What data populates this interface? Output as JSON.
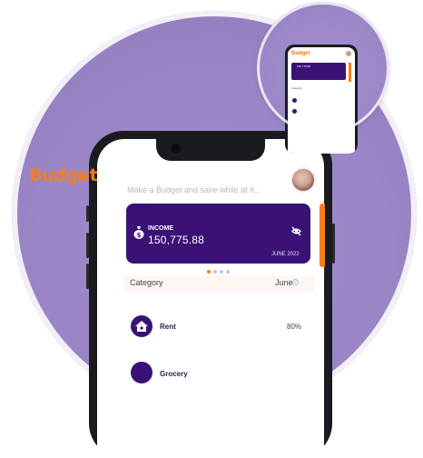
{
  "app": {
    "title": "Budget",
    "subtitle": "Make a Budget and save while at it..."
  },
  "income_card": {
    "label": "INCOME",
    "value": "150,775.88",
    "date": "JUNE 2022",
    "money_icon": "money-bag-icon",
    "eye_icon": "eye-off-icon"
  },
  "carousel": {
    "total": 4,
    "active_index": 0
  },
  "category_header": {
    "label": "Category",
    "month": "June"
  },
  "categories": [
    {
      "name": "Rent",
      "percent": "80%",
      "icon": "home-icon"
    },
    {
      "name": "Grocery",
      "percent": "",
      "icon": "cart-icon"
    }
  ],
  "mini": {
    "title": "Budget",
    "income_text": "150,775.88",
    "category": "Category"
  },
  "colors": {
    "accent": "#f47e20",
    "primary": "#3a1276",
    "background": "#9a86c6"
  }
}
